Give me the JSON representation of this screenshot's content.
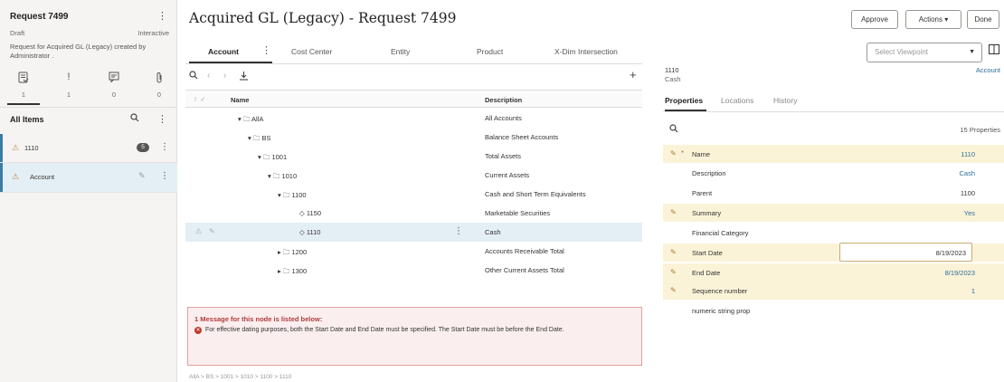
{
  "request": {
    "title": "Request 7499",
    "status": "Draft",
    "mode": "Interactive",
    "description": "Request for Acquired GL (Legacy) created by Administrator ."
  },
  "left_icons": [
    {
      "icon": "request-details-icon",
      "count": "1"
    },
    {
      "icon": "warning-icon",
      "count": "1"
    },
    {
      "icon": "comment-icon",
      "count": "0"
    },
    {
      "icon": "attachment-icon",
      "count": "0"
    }
  ],
  "items_panel": {
    "title": "All Items",
    "items": [
      {
        "label": "1110",
        "badge": "5"
      },
      {
        "label": "Account"
      }
    ]
  },
  "header": {
    "title": "Acquired GL (Legacy) - Request 7499",
    "approve": "Approve",
    "actions": "Actions",
    "done": "Done"
  },
  "tabs": [
    "Account",
    "Cost Center",
    "Entity",
    "Product",
    "X-Dim Intersection"
  ],
  "table": {
    "col_name": "Name",
    "col_desc": "Description",
    "rows": [
      {
        "name": "AllA",
        "desc": "All Accounts"
      },
      {
        "name": "BS",
        "desc": "Balance Sheet Accounts"
      },
      {
        "name": "1001",
        "desc": "Total Assets"
      },
      {
        "name": "1010",
        "desc": "Current Assets"
      },
      {
        "name": "1100",
        "desc": "Cash and Short Term Equivalents"
      },
      {
        "name": "1150",
        "desc": "Marketable Securities"
      },
      {
        "name": "1110",
        "desc": "Cash"
      },
      {
        "name": "1200",
        "desc": "Accounts Receivable Total"
      },
      {
        "name": "1300",
        "desc": "Other Current Assets Total"
      }
    ]
  },
  "error": {
    "heading": "1 Message for this node is listed below:",
    "message": "For effective dating purposes, both the Start Date and End Date must be specified. The Start Date must be before the End Date."
  },
  "breadcrumb": "AllA > BS > 1001 > 1010 > 1100 > 1110",
  "viewpoint": {
    "placeholder": "Select Viewpoint"
  },
  "node": {
    "code": "1110",
    "name": "Cash",
    "type": "Account"
  },
  "right_tabs": [
    "Properties",
    "Locations",
    "History"
  ],
  "properties_count": "15 Properties",
  "properties": [
    {
      "label": "Name",
      "value": "1110"
    },
    {
      "label": "Description",
      "value": "Cash"
    },
    {
      "label": "Parent",
      "value": "1100"
    },
    {
      "label": "Summary",
      "value": "Yes"
    },
    {
      "label": "Financial Category",
      "value": ""
    },
    {
      "label": "Start Date",
      "value": "8/19/2023"
    },
    {
      "label": "End Date",
      "value": "8/19/2023"
    },
    {
      "label": "Sequence number",
      "value": "1"
    },
    {
      "label": "numeric string prop",
      "value": ""
    }
  ],
  "colors": {
    "accent": "#2b6e9d",
    "error": "#b23b3b",
    "highlight": "#fbf3d7",
    "selected": "#e4eef5"
  }
}
